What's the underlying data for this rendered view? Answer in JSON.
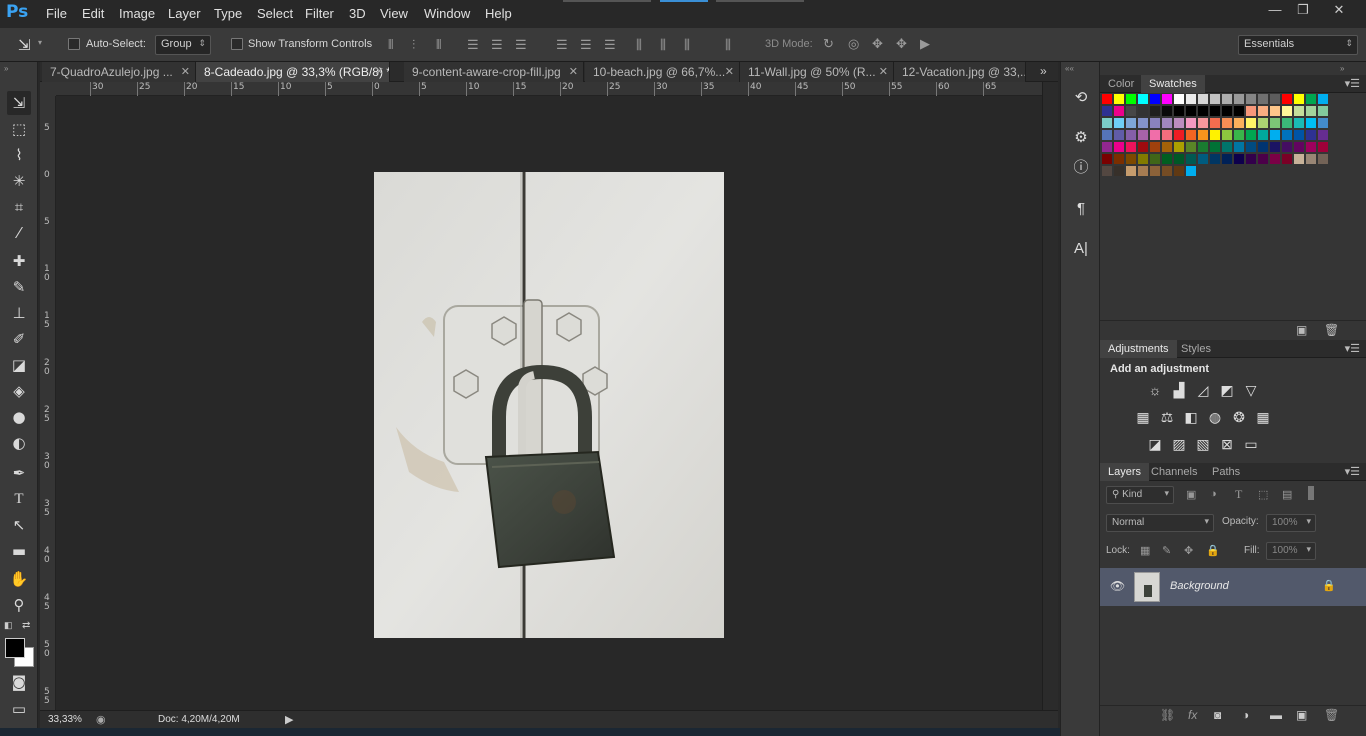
{
  "app": {
    "logo": "Ps"
  },
  "menu": [
    "File",
    "Edit",
    "Image",
    "Layer",
    "Type",
    "Select",
    "Filter",
    "3D",
    "View",
    "Window",
    "Help"
  ],
  "window_controls": [
    "—",
    "❐",
    "✕"
  ],
  "options_bar": {
    "auto_select_label": "Auto-Select:",
    "auto_select_value": "Group",
    "show_transform_label": "Show Transform Controls",
    "mode_3d_label": "3D Mode:",
    "workspace": "Essentials"
  },
  "tabs": [
    {
      "label": "7-QuadroAzulejo.jpg ..."
    },
    {
      "label": "8-Cadeado.jpg @ 33,3% (RGB/8) *",
      "active": true
    },
    {
      "label": "9-content-aware-crop-fill.jpg"
    },
    {
      "label": "10-beach.jpg @ 66,7%..."
    },
    {
      "label": "11-Wall.jpg @ 50% (R..."
    },
    {
      "label": "12-Vacation.jpg @ 33,..."
    }
  ],
  "ruler_h": [
    "30",
    "25",
    "20",
    "15",
    "10",
    "5",
    "0",
    "5",
    "10",
    "15",
    "20",
    "25",
    "30",
    "35",
    "40",
    "45",
    "50",
    "55",
    "60",
    "65"
  ],
  "ruler_v": [
    "5",
    "0",
    "5",
    "1 0",
    "1 5",
    "2 0",
    "2 5",
    "3 0",
    "3 5",
    "4 0",
    "4 5",
    "5 0",
    "5 5"
  ],
  "status": {
    "zoom": "33,33%",
    "doc": "Doc: 4,20M/4,20M"
  },
  "panels": {
    "color_tabs": [
      "Color",
      "Swatches"
    ],
    "adjust_tabs": [
      "Adjustments",
      "Styles"
    ],
    "add_adjustment": "Add an adjustment",
    "layers_tabs": [
      "Layers",
      "Channels",
      "Paths"
    ],
    "kind_label": "Kind",
    "blend_mode": "Normal",
    "opacity_label": "Opacity:",
    "opacity_value": "100%",
    "lock_label": "Lock:",
    "fill_label": "Fill:",
    "fill_value": "100%",
    "layer_name": "Background"
  },
  "swatch_colors": [
    "#ff0000",
    "#ffff00",
    "#00ff00",
    "#00ffff",
    "#0000ff",
    "#ff00ff",
    "#ffffff",
    "#ebebeb",
    "#d6d6d6",
    "#c2c2c2",
    "#adadad",
    "#999999",
    "#858585",
    "#707070",
    "#5c5c5c",
    "#ff0000",
    "#ffff00",
    "#00a650",
    "#00aeef",
    "#2e3192",
    "#ec008c",
    "#474747",
    "#333333",
    "#1f1f1f",
    "#0a0a0a",
    "#000000",
    "#000000",
    "#000000",
    "#000000",
    "#000000",
    "#000000",
    "#f7977a",
    "#f9ad81",
    "#fdc68a",
    "#fff79a",
    "#c4df9b",
    "#a3d39c",
    "#82ca9d",
    "#7bcdc8",
    "#6ecff6",
    "#7ea7d8",
    "#8493ca",
    "#8882be",
    "#a187be",
    "#bc8dbf",
    "#f49ac2",
    "#f6989d",
    "#f26c4f",
    "#f68e55",
    "#fbaf5c",
    "#fff467",
    "#acd372",
    "#7cc576",
    "#3bb878",
    "#1abbb4",
    "#00bff3",
    "#438ccb",
    "#5574b9",
    "#605ca8",
    "#855fa8",
    "#a763a8",
    "#f06ea9",
    "#f26d7d",
    "#ed1c24",
    "#f26522",
    "#f7941d",
    "#fff200",
    "#8dc73f",
    "#39b54a",
    "#00a651",
    "#00a99d",
    "#00aeef",
    "#0072bc",
    "#0054a6",
    "#2e3192",
    "#662d91",
    "#92278f",
    "#ec008c",
    "#ed145b",
    "#9e0b0f",
    "#a0410d",
    "#a36209",
    "#aba000",
    "#598527",
    "#1a7b30",
    "#007236",
    "#00746b",
    "#0076a3",
    "#004b80",
    "#003471",
    "#1b1464",
    "#440e62",
    "#630460",
    "#9e005d",
    "#9e0039",
    "#790000",
    "#7b2e00",
    "#7d4900",
    "#827b00",
    "#406618",
    "#005e20",
    "#005826",
    "#005952",
    "#005b7f",
    "#003663",
    "#002157",
    "#0d004c",
    "#32004b",
    "#4b0049",
    "#7b0046",
    "#7a0026",
    "#c7b299",
    "#998675",
    "#736357",
    "#534741",
    "#37302a",
    "#c69c6d",
    "#a67c52",
    "#8c6239",
    "#754c24",
    "#603913",
    "#00aeef"
  ]
}
